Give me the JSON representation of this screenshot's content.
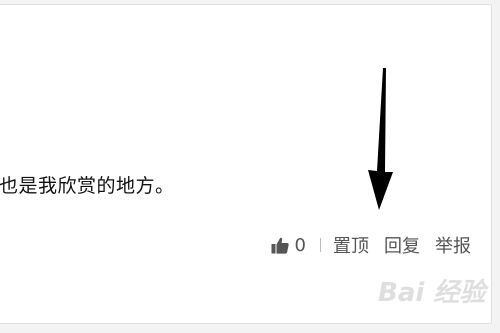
{
  "comment": {
    "text": "也是我欣赏的地方。"
  },
  "actions": {
    "like_icon": "thumbs-up-icon",
    "like_count": "0",
    "pin_label": "置顶",
    "reply_label": "回复",
    "report_label": "举报"
  },
  "colors": {
    "text": "#111111",
    "action_text": "#555555",
    "arrow": "#000000"
  },
  "watermark": {
    "text": "Bai 经验"
  }
}
